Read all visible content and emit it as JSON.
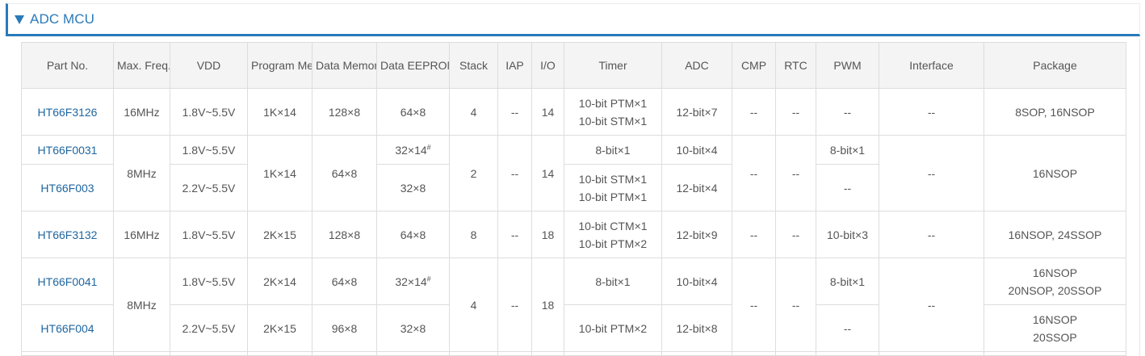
{
  "section": {
    "title": "ADC MCU",
    "toggle_icon": "triangle-down-icon",
    "accent_color": "#2a7ab9"
  },
  "table": {
    "headers": {
      "part_no": "Part No.",
      "max_freq_1": "Max.",
      "max_freq_2": "Freq.",
      "vdd": "VDD",
      "program_memory_1": "Program",
      "program_memory_2": "Memory",
      "data_memory_1": "Data",
      "data_memory_2": "Memory",
      "data_eeprom_1": "Data",
      "data_eeprom_2": "EEPROM",
      "stack": "Stack",
      "iap": "IAP",
      "io": "I/O",
      "timer": "Timer",
      "adc": "ADC",
      "cmp": "CMP",
      "rtc": "RTC",
      "pwm": "PWM",
      "interface": "Interface",
      "package": "Package"
    },
    "rows": {
      "r1": {
        "part": "HT66F3126",
        "freq": "16MHz",
        "vdd": "1.8V~5.5V",
        "prog": "1K×14",
        "data": "128×8",
        "eeprom": "64×8",
        "stack": "4",
        "iap": "--",
        "io": "14",
        "timer1": "10-bit PTM×1",
        "timer2": "10-bit STM×1",
        "adc": "12-bit×7",
        "cmp": "--",
        "rtc": "--",
        "pwm": "--",
        "interface": "--",
        "package": "8SOP, 16NSOP"
      },
      "r2": {
        "part": "HT66F0031",
        "vdd": "1.8V~5.5V",
        "eeprom": "32×14",
        "eeprom_mark": "#",
        "timer": "8-bit×1",
        "adc": "10-bit×4",
        "pwm": "8-bit×1"
      },
      "g1": {
        "freq": "8MHz",
        "prog": "1K×14",
        "data": "64×8",
        "stack": "2",
        "iap": "--",
        "io": "14",
        "cmp": "--",
        "rtc": "--",
        "interface": "--",
        "package": "16NSOP"
      },
      "r3": {
        "part": "HT66F003",
        "vdd": "2.2V~5.5V",
        "eeprom": "32×8",
        "timer1": "10-bit STM×1",
        "timer2": "10-bit PTM×1",
        "adc": "12-bit×4",
        "pwm": "--"
      },
      "r4": {
        "part": "HT66F3132",
        "freq": "16MHz",
        "vdd": "1.8V~5.5V",
        "prog": "2K×15",
        "data": "128×8",
        "eeprom": "64×8",
        "stack": "8",
        "iap": "--",
        "io": "18",
        "timer1": "10-bit CTM×1",
        "timer2": "10-bit PTM×2",
        "adc": "12-bit×9",
        "cmp": "--",
        "rtc": "--",
        "pwm": "10-bit×3",
        "interface": "--",
        "package": "16NSOP, 24SSOP"
      },
      "r5": {
        "part": "HT66F0041",
        "vdd": "1.8V~5.5V",
        "prog": "2K×14",
        "data": "64×8",
        "eeprom": "32×14",
        "eeprom_mark": "#",
        "timer": "8-bit×1",
        "adc": "10-bit×4",
        "pwm": "8-bit×1",
        "package1": "16NSOP",
        "package2": "20NSOP, 20SSOP"
      },
      "g2": {
        "freq": "8MHz",
        "stack": "4",
        "iap": "--",
        "io": "18",
        "cmp": "--",
        "rtc": "--",
        "interface": "--"
      },
      "r6": {
        "part": "HT66F004",
        "vdd": "2.2V~5.5V",
        "prog": "2K×15",
        "data": "96×8",
        "eeprom": "32×8",
        "timer": "10-bit PTM×2",
        "adc": "12-bit×8",
        "pwm": "--",
        "package1": "16NSOP",
        "package2": "20SSOP"
      }
    }
  }
}
